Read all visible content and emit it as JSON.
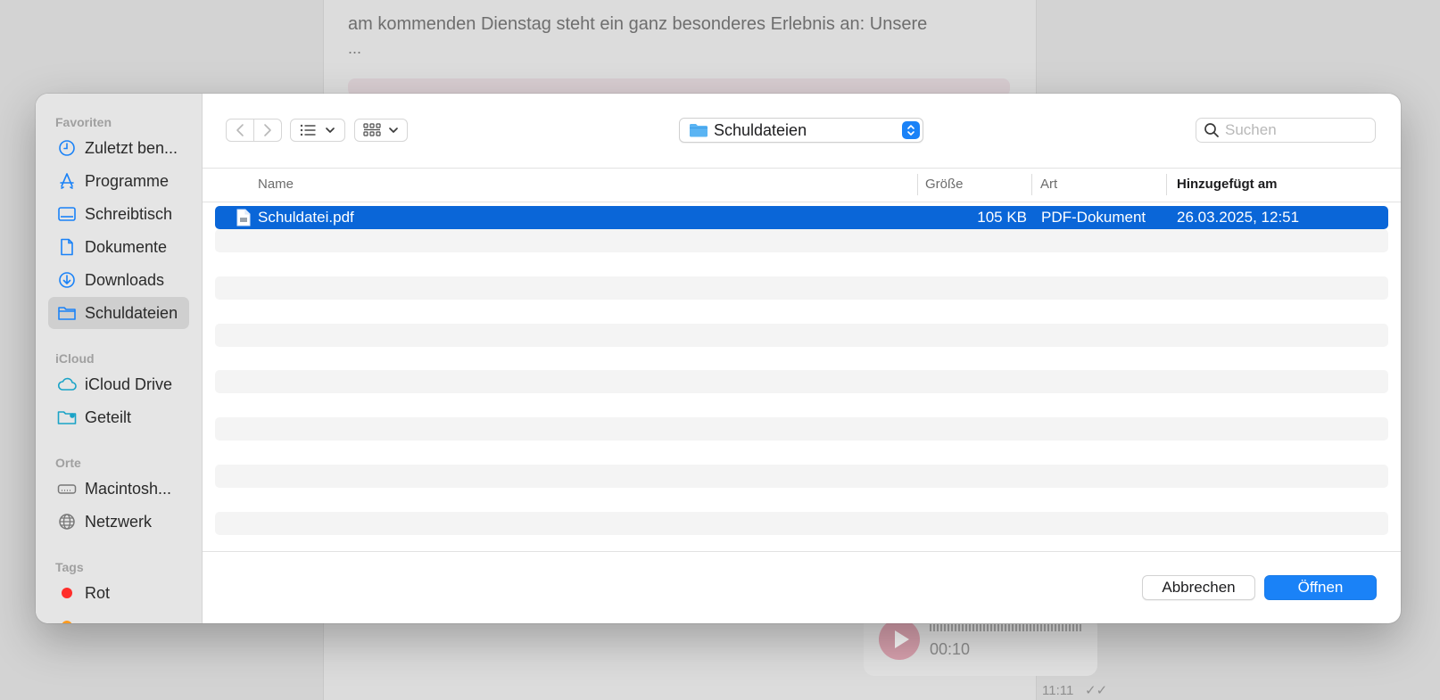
{
  "background": {
    "message_text": "am kommenden Dienstag steht ein ganz besonderes Erlebnis an: Unsere",
    "message_ellipsis": "...",
    "voice_duration": "00:10",
    "message_time": "11:11"
  },
  "sidebar": {
    "sections": [
      {
        "title": "Favoriten",
        "items": [
          {
            "label": "Zuletzt ben...",
            "icon": "clock-icon"
          },
          {
            "label": "Programme",
            "icon": "apps-icon"
          },
          {
            "label": "Schreibtisch",
            "icon": "desktop-icon"
          },
          {
            "label": "Dokumente",
            "icon": "document-icon"
          },
          {
            "label": "Downloads",
            "icon": "download-icon"
          },
          {
            "label": "Schuldateien",
            "icon": "folder-icon",
            "selected": true
          }
        ]
      },
      {
        "title": "iCloud",
        "items": [
          {
            "label": "iCloud Drive",
            "icon": "cloud-icon"
          },
          {
            "label": "Geteilt",
            "icon": "shared-folder-icon"
          }
        ]
      },
      {
        "title": "Orte",
        "items": [
          {
            "label": "Macintosh...",
            "icon": "hard-drive-icon"
          },
          {
            "label": "Netzwerk",
            "icon": "globe-icon"
          }
        ]
      },
      {
        "title": "Tags",
        "items": [
          {
            "label": "Rot",
            "icon": "red-tag-dot",
            "color": "#ff2d2a"
          }
        ]
      }
    ]
  },
  "toolbar": {
    "current_folder": "Schuldateien",
    "search_placeholder": "Suchen",
    "view_mode": "list"
  },
  "columns": {
    "name": "Name",
    "size": "Größe",
    "kind": "Art",
    "date_added": "Hinzugefügt am",
    "sorted_by": "date_added"
  },
  "files": [
    {
      "name": "Schuldatei.pdf",
      "size": "105 KB",
      "kind": "PDF-Dokument",
      "date_added": "26.03.2025, 12:51",
      "selected": true
    }
  ],
  "buttons": {
    "cancel": "Abbrechen",
    "open": "Öffnen"
  },
  "colors": {
    "accent": "#1a82f7",
    "selection": "#0a66d8",
    "tag_red": "#ff2d2a"
  }
}
